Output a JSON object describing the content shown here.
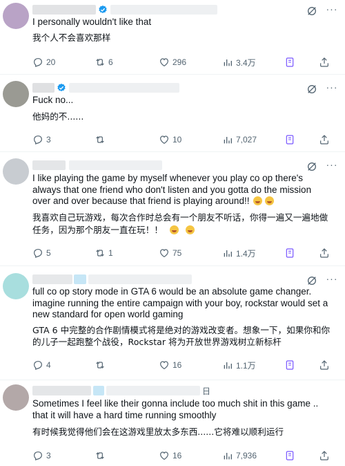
{
  "posts": [
    {
      "text_en": "I personally wouldn't like that",
      "text_cn": "我个人不会喜欢那样",
      "replies": "20",
      "reposts": "6",
      "likes": "296",
      "views": "3.4万",
      "avatar_color": "#b9a3c6"
    },
    {
      "text_en": "Fuck no...",
      "text_cn": "他妈的不......",
      "replies": "3",
      "reposts": "",
      "likes": "10",
      "views": "7,027",
      "avatar_color": "#9a9a93"
    },
    {
      "text_en": "I like playing the game by myself whenever you play co op there's always that one friend who don't listen and you gotta do the mission over and over because that friend is playing around!!",
      "text_cn_line1": "我喜欢自己玩游戏，每次合作时总会有一个朋友不听话，你得一遍又一遍地做",
      "text_cn_line2": "任务，因为那个朋友一直在玩！！",
      "replies": "5",
      "reposts": "1",
      "likes": "75",
      "views": "1.4万",
      "avatar_color": "#c8ccd1"
    },
    {
      "text_en": "full co op story mode in GTA 6 would be an absolute game changer. imagine running the entire campaign with your boy, rockstar would set a new standard for open world gaming",
      "text_cn": "GTA 6 中完整的合作剧情模式将是绝对的游戏改变者。想象一下，如果你和你的儿子一起跑整个战役，Rockstar 将为开放世界游戏树立新标杆",
      "replies": "4",
      "reposts": "",
      "likes": "16",
      "views": "1.1万",
      "avatar_color": "#a8dede"
    },
    {
      "name_fragment": "日",
      "text_en": "Sometimes I feel like their gonna include too much shit in this game .. that it will have a hard time running smoothly",
      "text_cn": "有时候我觉得他们会在这游戏里放太多东西......它将难以顺利运行",
      "replies": "3",
      "reposts": "",
      "likes": "16",
      "views": "7,936",
      "avatar_color": "#b3a8a8"
    }
  ],
  "colors": {
    "icon_gray": "#536471",
    "bookmark_purple": "#7856ff",
    "verified_blue": "#1d9bf0",
    "divider": "#eff3f4"
  },
  "icons": [
    "reply-icon",
    "repost-icon",
    "like-icon",
    "views-icon",
    "bookmark-icon",
    "share-icon",
    "grok-icon",
    "more-icon",
    "verified-icon"
  ]
}
